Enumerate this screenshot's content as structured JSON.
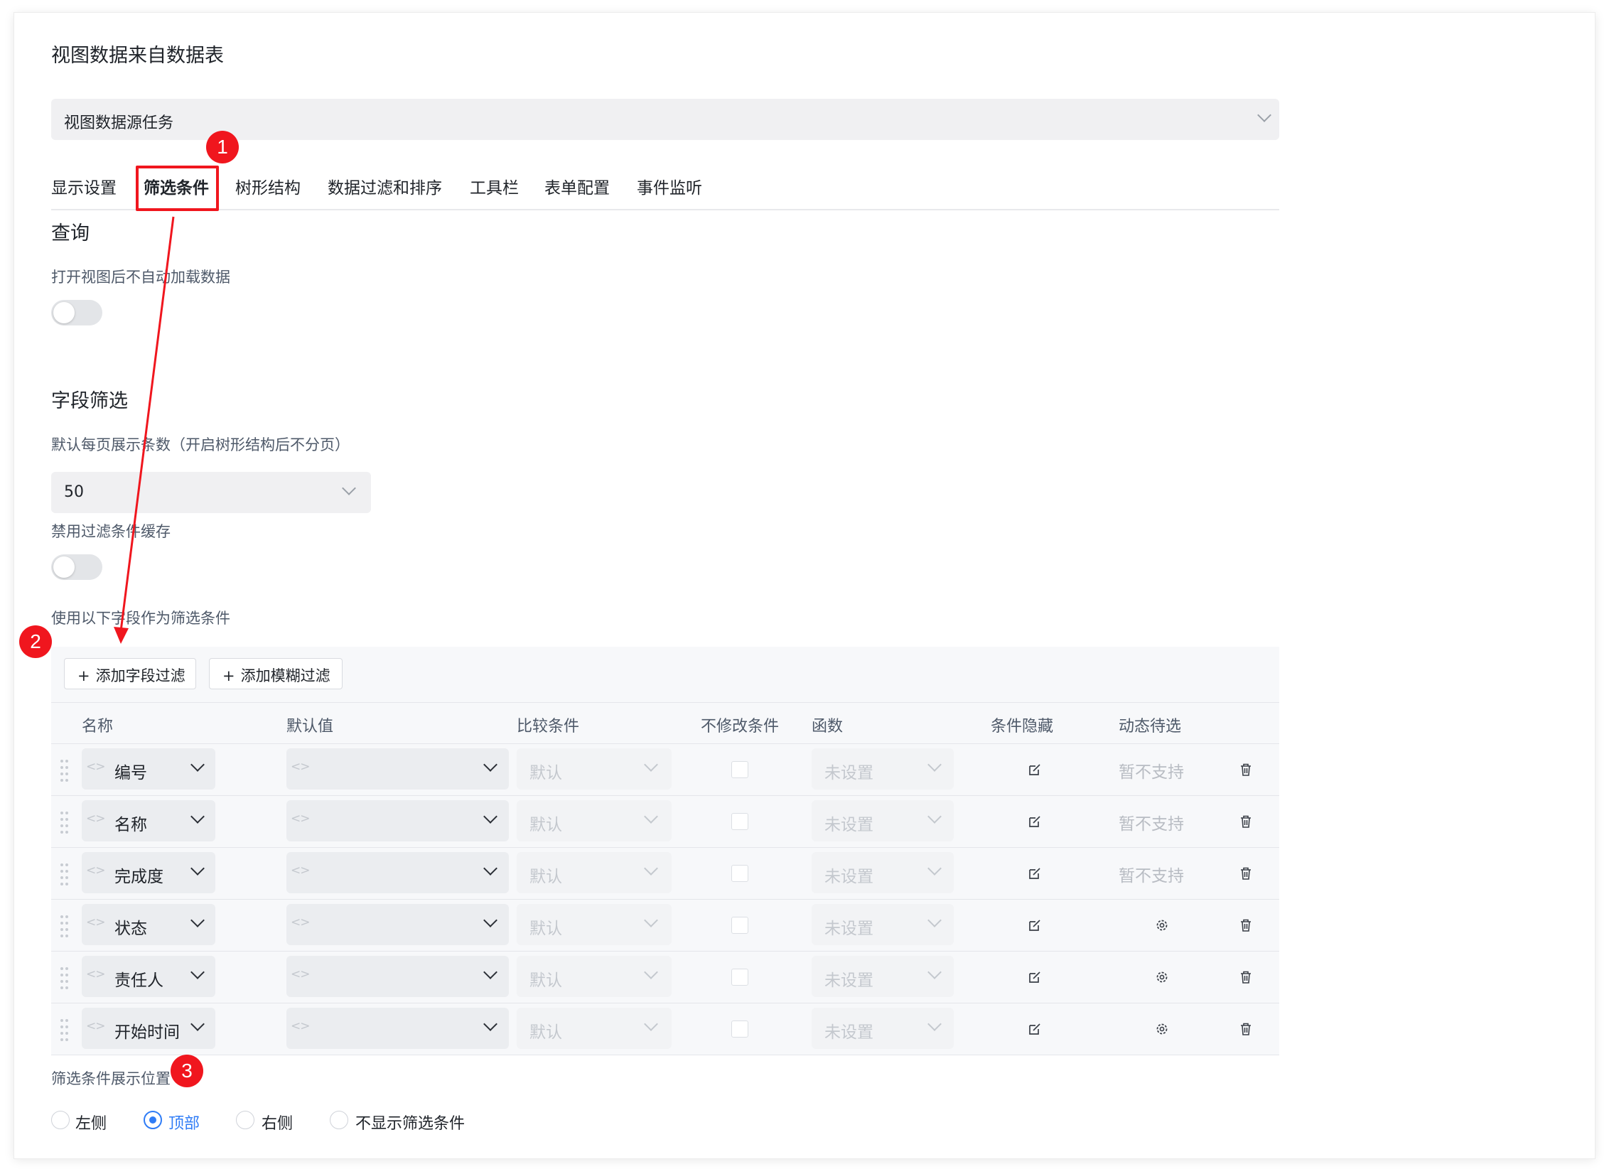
{
  "header": {
    "title": "视图数据来自数据表",
    "source_select": "视图数据源任务"
  },
  "tabs": [
    "显示设置",
    "筛选条件",
    "树形结构",
    "数据过滤和排序",
    "工具栏",
    "表单配置",
    "事件监听"
  ],
  "query": {
    "title": "查询",
    "auto_load_label": "打开视图后不自动加载数据"
  },
  "field_filter": {
    "title": "字段筛选",
    "page_size_label": "默认每页展示条数（开启树形结构后不分页）",
    "page_size_value": "50",
    "disable_cache_label": "禁用过滤条件缓存",
    "use_fields_label": "使用以下字段作为筛选条件",
    "add_field_filter": "添加字段过滤",
    "add_fuzzy_filter": "添加模糊过滤"
  },
  "table": {
    "columns": [
      "名称",
      "默认值",
      "比较条件",
      "不修改条件",
      "函数",
      "条件隐藏",
      "动态待选"
    ],
    "rows": [
      {
        "name": "编号",
        "compare": "默认",
        "func": "未设置",
        "dynamic": "暂不支持"
      },
      {
        "name": "名称",
        "compare": "默认",
        "func": "未设置",
        "dynamic": "暂不支持"
      },
      {
        "name": "完成度",
        "compare": "默认",
        "func": "未设置",
        "dynamic": "暂不支持"
      },
      {
        "name": "状态",
        "compare": "默认",
        "func": "未设置",
        "dynamic": "gear-icon"
      },
      {
        "name": "责任人",
        "compare": "默认",
        "func": "未设置",
        "dynamic": "gear-icon"
      },
      {
        "name": "开始时间",
        "compare": "默认",
        "func": "未设置",
        "dynamic": "gear-icon"
      }
    ],
    "code_icon": "<>"
  },
  "position": {
    "label": "筛选条件展示位置",
    "options": [
      "左侧",
      "顶部",
      "右侧",
      "不显示筛选条件"
    ],
    "selected": "顶部"
  },
  "annotations": {
    "badges": [
      "1",
      "2",
      "3"
    ],
    "highlight_color": "#f0161e"
  },
  "colors": {
    "accent": "#2f7cf6",
    "annotation": "#f0161e"
  }
}
